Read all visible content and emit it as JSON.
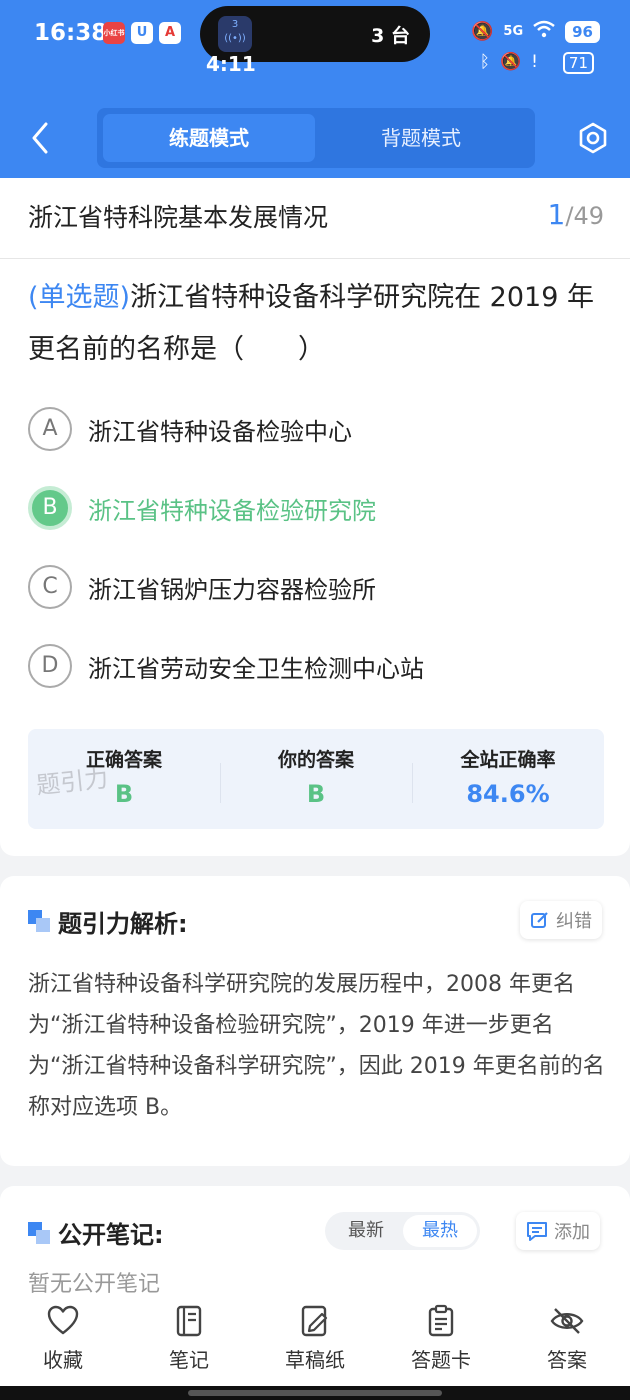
{
  "status_bar": {
    "time": "16:38",
    "app_badges": [
      "小红书",
      "U",
      "A"
    ],
    "island_text": "3 台",
    "sub_time": "4:11",
    "network": "5G",
    "battery": "96",
    "battery2": "71"
  },
  "header": {
    "tabs": [
      {
        "label": "练题模式",
        "active": true
      },
      {
        "label": "背题模式",
        "active": false
      }
    ]
  },
  "question": {
    "section_title": "浙江省特科院基本发展情况",
    "current": "1",
    "total": "/49",
    "type_label": "(单选题)",
    "text": "浙江省特种设备科学研究院在 2019 年更名前的名称是（　　）",
    "options": [
      {
        "letter": "A",
        "text": "浙江省特种设备检验中心",
        "correct": false
      },
      {
        "letter": "B",
        "text": "浙江省特种设备检验研究院",
        "correct": true
      },
      {
        "letter": "C",
        "text": "浙江省锅炉压力容器检验所",
        "correct": false
      },
      {
        "letter": "D",
        "text": "浙江省劳动安全卫生检测中心站",
        "correct": false
      }
    ],
    "stats": [
      {
        "label": "正确答案",
        "value": "B",
        "color": "#5ac285"
      },
      {
        "label": "你的答案",
        "value": "B",
        "color": "#5ac285"
      },
      {
        "label": "全站正确率",
        "value": "84.6%",
        "color": "#3d87f2"
      }
    ],
    "watermark": "题引力"
  },
  "analysis": {
    "title": "题引力解析:",
    "report_label": "纠错",
    "text": "浙江省特种设备科学研究院的发展历程中，2008 年更名为“浙江省特种设备检验研究院”，2019 年进一步更名为“浙江省特种设备科学研究院”，因此 2019 年更名前的名称对应选项 B。"
  },
  "notes": {
    "title": "公开笔记:",
    "sort_options": [
      "最新",
      "最热"
    ],
    "add_label": "添加",
    "empty_text": "暂无公开笔记"
  },
  "bottom_nav": [
    {
      "label": "收藏",
      "icon": "heart-icon"
    },
    {
      "label": "笔记",
      "icon": "notebook-icon"
    },
    {
      "label": "草稿纸",
      "icon": "draft-icon"
    },
    {
      "label": "答题卡",
      "icon": "answer-sheet-icon"
    },
    {
      "label": "答案",
      "icon": "eye-off-icon"
    }
  ],
  "colors": {
    "primary": "#3d87f2",
    "correct": "#5ac285"
  }
}
